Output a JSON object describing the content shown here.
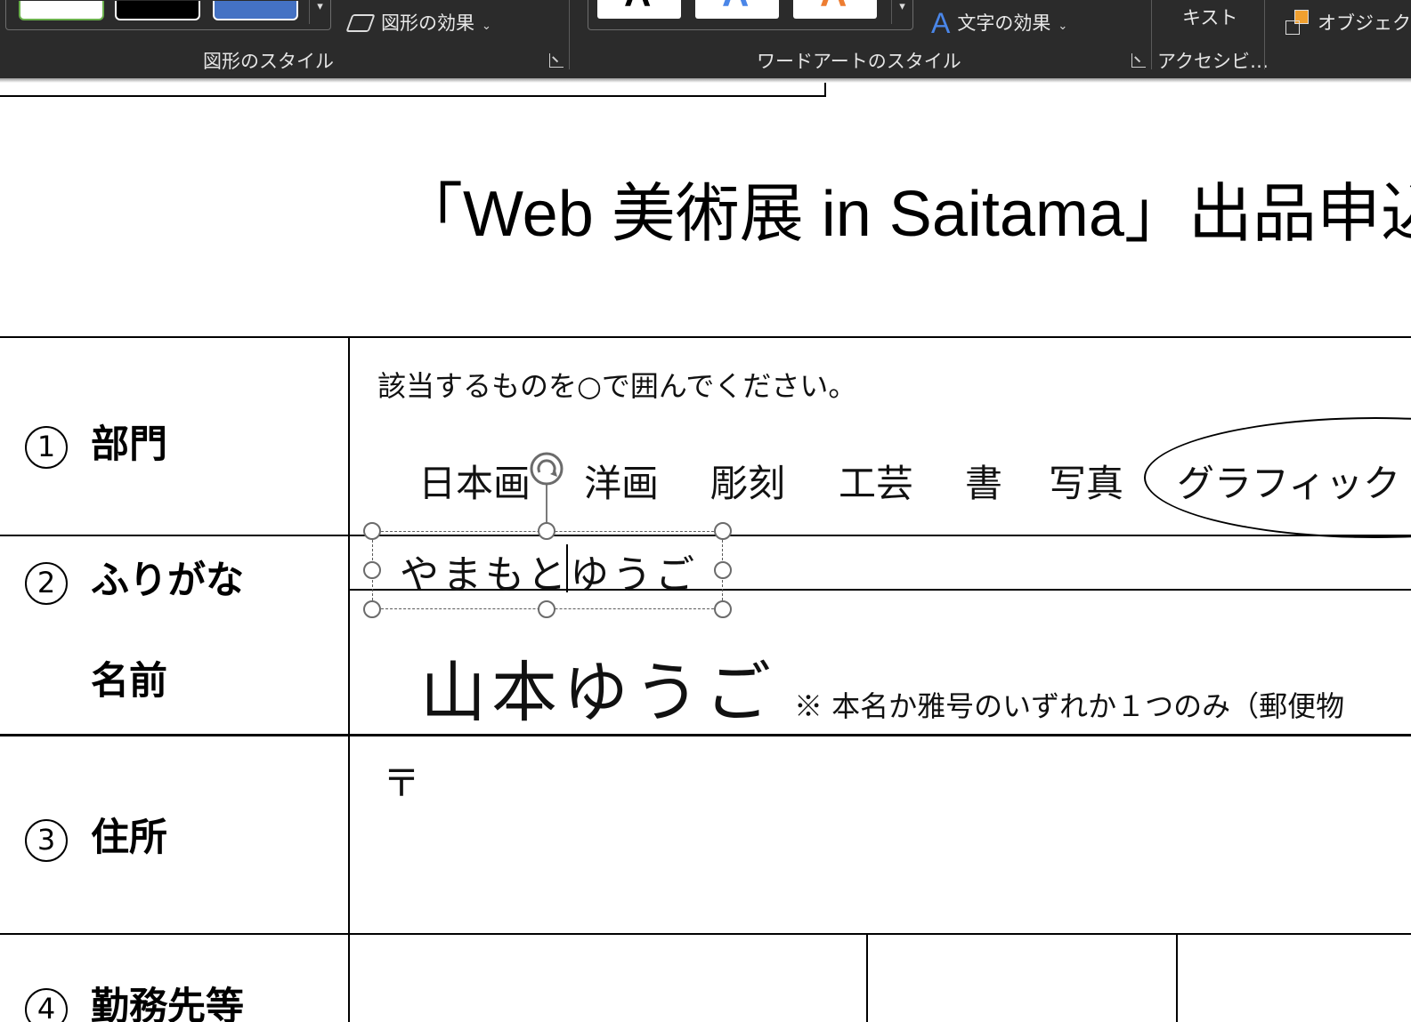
{
  "ribbon": {
    "shape_effects_label": "図形の効果",
    "shape_styles_group": "図形のスタイル",
    "text_effects_label": "文字の効果",
    "wordart_styles_group": "ワードアートのスタイル",
    "alt_text_label": "キスト",
    "accessibility_group": "アクセシビ…",
    "object_label": "オブジェク",
    "wordart_glyph": "A",
    "colors": {
      "bg": "#2b2b2b",
      "swatch_green": "#6ab04c",
      "swatch_black": "#000000",
      "swatch_blue": "#4472c4",
      "wa_blue": "#4a86e8",
      "wa_orange": "#ed7d31"
    }
  },
  "document": {
    "title": "「Web 美術展 in Saitama」出品申込",
    "rows": [
      {
        "num": "1",
        "label": "部門"
      },
      {
        "num": "2",
        "label": "ふりがな"
      },
      {
        "num": "",
        "label": "名前"
      },
      {
        "num": "3",
        "label": "住所"
      },
      {
        "num": "4",
        "label": "勤務先等"
      }
    ],
    "instruction": "該当するものを○で囲んでください。",
    "categories": [
      "日本画",
      "洋画",
      "彫刻",
      "工芸",
      "書",
      "写真",
      "グラフィック"
    ],
    "furigana_value": "やまもとゆうご",
    "name_value": "山本ゆうご",
    "name_note": "※ 本名か雅号のいずれか１つのみ（郵便物",
    "postal_mark": "〒"
  }
}
